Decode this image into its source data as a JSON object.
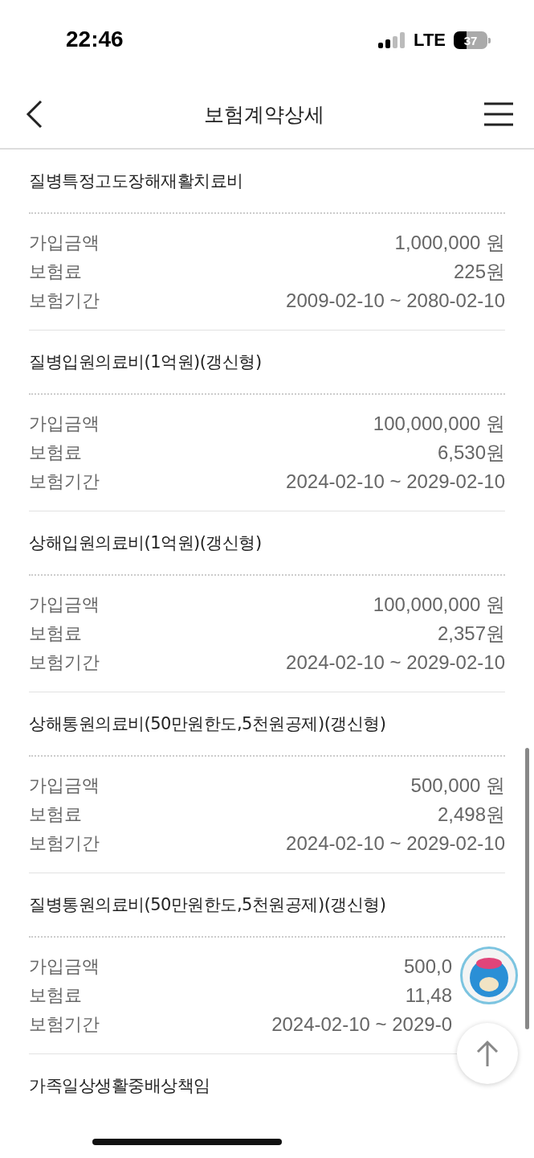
{
  "status_bar": {
    "time": "22:46",
    "network": "LTE",
    "battery": "37"
  },
  "header": {
    "title": "보험계약상세"
  },
  "sections": [
    {
      "title": "질병특정고도장해재활치료비",
      "covered": false,
      "rows": [
        {
          "label": "가입금액",
          "value": "1,000,000 원"
        },
        {
          "label": "보험료",
          "value": "225원"
        },
        {
          "label": "보험기간",
          "value": "2009-02-10 ~ 2080-02-10"
        }
      ]
    },
    {
      "title": "질병입원의료비(1억원)(갱신형)",
      "covered": false,
      "rows": [
        {
          "label": "가입금액",
          "value": "100,000,000 원"
        },
        {
          "label": "보험료",
          "value": "6,530원"
        },
        {
          "label": "보험기간",
          "value": "2024-02-10 ~ 2029-02-10"
        }
      ]
    },
    {
      "title": "상해입원의료비(1억원)(갱신형)",
      "covered": false,
      "rows": [
        {
          "label": "가입금액",
          "value": "100,000,000 원"
        },
        {
          "label": "보험료",
          "value": "2,357원"
        },
        {
          "label": "보험기간",
          "value": "2024-02-10 ~ 2029-02-10"
        }
      ]
    },
    {
      "title": "상해통원의료비(50만원한도,5천원공제)(갱신형)",
      "covered": false,
      "rows": [
        {
          "label": "가입금액",
          "value": "500,000 원"
        },
        {
          "label": "보험료",
          "value": "2,498원"
        },
        {
          "label": "보험기간",
          "value": "2024-02-10 ~ 2029-02-10"
        }
      ]
    },
    {
      "title": "질병통원의료비(50만원한도,5천원공제)(갱신형)",
      "covered": true,
      "rows": [
        {
          "label": "가입금액",
          "value": "500,0"
        },
        {
          "label": "보험료",
          "value": "11,48"
        },
        {
          "label": "보험기간",
          "value": "2024-02-10 ~ 2029-0"
        }
      ]
    },
    {
      "title": "가족일상생활중배상책임"
    }
  ]
}
